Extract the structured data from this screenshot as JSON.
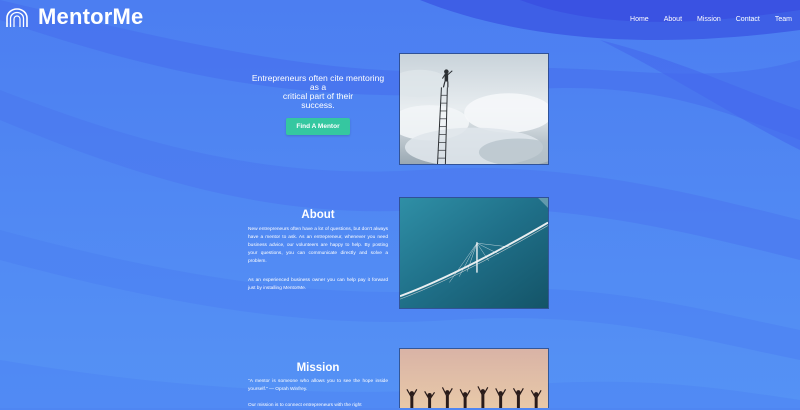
{
  "brand": {
    "name": "MentorMe"
  },
  "nav": {
    "items": [
      "Home",
      "About",
      "Mission",
      "Contact",
      "Team"
    ]
  },
  "hero": {
    "text_lines": [
      "Entrepreneurs often cite mentoring",
      "as a",
      "critical part of their",
      "success."
    ],
    "cta_label": "Find A Mentor"
  },
  "about": {
    "title": "About",
    "paragraph1": "New entrepreneurs often have a lot of questions, but don't always have a mentor to ask. As an entrepreneur, whenever you need business advice, our volunteers are happy to help. By posting your questions, you can communicate directly and solve a problem.",
    "paragraph2": "As an experienced business owner you can help pay it forward just by installing MentorMe."
  },
  "mission": {
    "title": "Mission",
    "quote": "\"A mentor is someone who allows you to see the hope inside yourself.\" — Oprah Winfrey.",
    "paragraph": "Our mission is to connect entrepreneurs with the right"
  },
  "images": {
    "hero": "person-on-ladder-in-clouds",
    "about": "bridge-over-sea-aerial",
    "mission": "silhouettes-jumping-sunset"
  },
  "colors": {
    "background": "#4f86f2",
    "accent": "#35c7a0",
    "text": "#ffffff"
  }
}
